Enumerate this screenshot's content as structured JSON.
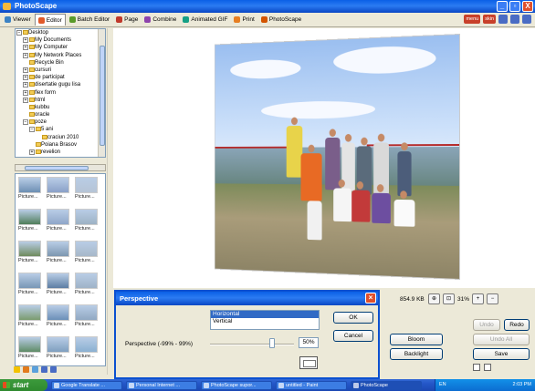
{
  "window": {
    "title": "PhotoScape",
    "min": "_",
    "max": "▫",
    "close": "X"
  },
  "tabs": [
    {
      "label": "Viewer",
      "color": "#3b82c4"
    },
    {
      "label": "Editor",
      "color": "#e05a2a",
      "active": true
    },
    {
      "label": "Batch Editor",
      "color": "#5a9a2a"
    },
    {
      "label": "Page",
      "color": "#c0392b"
    },
    {
      "label": "Combine",
      "color": "#8e44ad"
    },
    {
      "label": "Animated GIF",
      "color": "#16a085"
    },
    {
      "label": "Print",
      "color": "#e67e22"
    },
    {
      "label": "PhotoScape",
      "color": "#d35400"
    }
  ],
  "toolbar_right": [
    "menu",
    "skin"
  ],
  "tree": [
    {
      "label": "Desktop",
      "indent": 0,
      "pm": "−"
    },
    {
      "label": "My Documents",
      "indent": 1,
      "pm": "+"
    },
    {
      "label": "My Computer",
      "indent": 1,
      "pm": "+"
    },
    {
      "label": "My Network Places",
      "indent": 1,
      "pm": "+"
    },
    {
      "label": "Recycle Bin",
      "indent": 1,
      "pm": ""
    },
    {
      "label": "cursuri",
      "indent": 1,
      "pm": "+"
    },
    {
      "label": "de participat",
      "indent": 1,
      "pm": "+"
    },
    {
      "label": "disertatie gugu lisa",
      "indent": 1,
      "pm": "+"
    },
    {
      "label": "flex form",
      "indent": 1,
      "pm": "+"
    },
    {
      "label": "html",
      "indent": 1,
      "pm": "+"
    },
    {
      "label": "kubbu",
      "indent": 1,
      "pm": ""
    },
    {
      "label": "oracle",
      "indent": 1,
      "pm": ""
    },
    {
      "label": "poze",
      "indent": 1,
      "pm": "−"
    },
    {
      "label": "5 ani",
      "indent": 2,
      "pm": "−"
    },
    {
      "label": "craciun 2010",
      "indent": 3,
      "pm": ""
    },
    {
      "label": "Poiana Brasov",
      "indent": 2,
      "pm": ""
    },
    {
      "label": "revelion",
      "indent": 2,
      "pm": "+"
    }
  ],
  "thumbnails": {
    "label": "Picture...",
    "colors": [
      "#6d8fb3",
      "#8aa0c8",
      "#b6c4d6",
      "#4f7e5a",
      "#8fa6c9",
      "#9db2c4",
      "#6f8b5e",
      "#7d97b0",
      "#a7b8c9",
      "#7896b5",
      "#5d7ea3",
      "#9fb3c7",
      "#7a9b6e",
      "#6b8fb8",
      "#90a8c2",
      "#5f8b66",
      "#7f9fbf",
      "#8ab0d1"
    ]
  },
  "status": {
    "file_size": "854.9 KB",
    "zoom": "31%"
  },
  "buttons": {
    "undo": "Undo",
    "redo": "Redo",
    "undo_all": "Undo All",
    "save": "Save",
    "bloom": "Bloom",
    "backlight": "Backlight"
  },
  "dialog": {
    "title": "Perspective",
    "options": [
      "Horizontal",
      "Vertical"
    ],
    "selected": "Horizontal",
    "ok": "OK",
    "cancel": "Cancel",
    "slider_label": "Perspective (-99% - 99%)",
    "value": "50%",
    "slider_fraction": 0.75
  },
  "taskbar": {
    "start": "start",
    "items": [
      {
        "label": "Google Translate ...",
        "active": false
      },
      {
        "label": "Personal Internet ...",
        "active": false
      },
      {
        "label": "PhotoScape supor...",
        "active": false
      },
      {
        "label": "untitled - Paint",
        "active": false
      },
      {
        "label": "PhotoScape",
        "active": true
      }
    ],
    "lang": "EN",
    "clock": "2:03 PM"
  }
}
